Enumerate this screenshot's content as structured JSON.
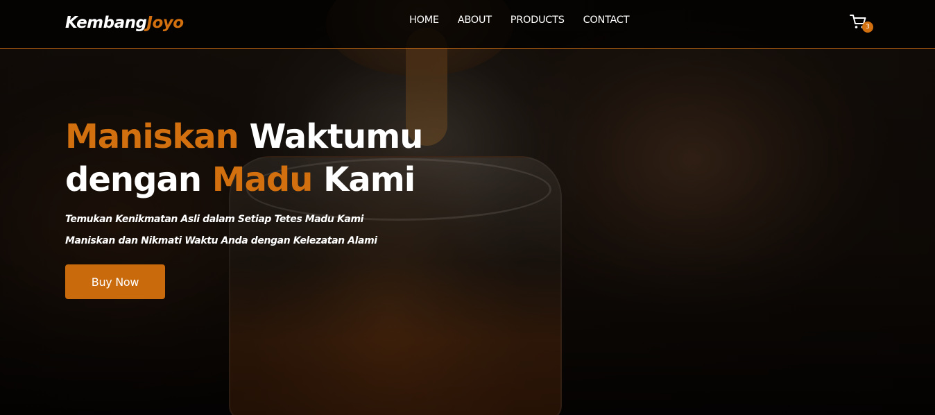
{
  "brand": {
    "part1": "Kembang",
    "part2": "Joyo"
  },
  "nav": {
    "items": [
      {
        "label": "HOME"
      },
      {
        "label": "ABOUT"
      },
      {
        "label": "PRODUCTS"
      },
      {
        "label": "CONTACT"
      }
    ]
  },
  "cart": {
    "count": "3",
    "icon": "cart-icon"
  },
  "hero": {
    "headline": {
      "line1_accent": "Maniskan",
      "line1_rest": " Waktumu",
      "line2_start": "dengan ",
      "line2_accent": "Madu",
      "line2_end": " Kami"
    },
    "subtitle_lines": [
      "Temukan Kenikmatan Asli dalam Setiap Tetes Madu Kami",
      "Maniskan dan Nikmati Waktu Anda dengan Kelezatan Alami"
    ],
    "button_label": "Buy Now"
  },
  "colors": {
    "accent": "#d2700f",
    "button": "#c96a0c",
    "navbar_border": "#c56a12"
  }
}
